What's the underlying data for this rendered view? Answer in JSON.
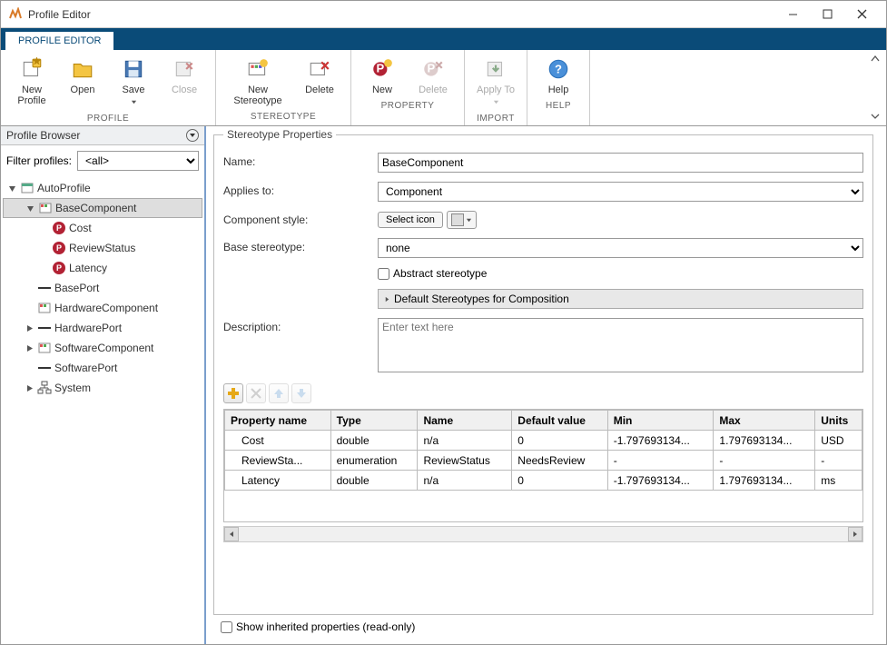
{
  "window": {
    "title": "Profile Editor"
  },
  "ribbon": {
    "tab": "PROFILE EDITOR",
    "groups": {
      "profile": {
        "name": "PROFILE",
        "new": "New Profile",
        "open": "Open",
        "save": "Save",
        "close": "Close"
      },
      "stereotype": {
        "name": "STEREOTYPE",
        "new": "New Stereotype",
        "delete": "Delete"
      },
      "property": {
        "name": "PROPERTY",
        "new": "New",
        "delete": "Delete"
      },
      "import": {
        "name": "IMPORT",
        "apply": "Apply To"
      },
      "help": {
        "name": "HELP",
        "help": "Help"
      }
    }
  },
  "browser": {
    "title": "Profile Browser",
    "filter_label": "Filter profiles:",
    "filter_value": "<all>",
    "tree": {
      "root": "AutoProfile",
      "items": [
        {
          "label": "BaseComponent",
          "icon": "grid",
          "indent": 1,
          "tw": "open",
          "selected": true
        },
        {
          "label": "Cost",
          "icon": "P",
          "indent": 2
        },
        {
          "label": "ReviewStatus",
          "icon": "P",
          "indent": 2
        },
        {
          "label": "Latency",
          "icon": "P",
          "indent": 2
        },
        {
          "label": "BasePort",
          "icon": "dash",
          "indent": 1
        },
        {
          "label": "HardwareComponent",
          "icon": "grid",
          "indent": 1
        },
        {
          "label": "HardwarePort",
          "icon": "dash",
          "indent": 1,
          "tw": "closed"
        },
        {
          "label": "SoftwareComponent",
          "icon": "grid",
          "indent": 1,
          "tw": "closed"
        },
        {
          "label": "SoftwarePort",
          "icon": "dash",
          "indent": 1
        },
        {
          "label": "System",
          "icon": "hier",
          "indent": 1,
          "tw": "closed"
        }
      ]
    }
  },
  "stereotype": {
    "legend": "Stereotype Properties",
    "labels": {
      "name": "Name:",
      "applies": "Applies to:",
      "compstyle": "Component style:",
      "base": "Base stereotype:",
      "abstract": "Abstract stereotype",
      "defaults": "Default Stereotypes for Composition",
      "description": "Description:",
      "select_icon": "Select icon"
    },
    "values": {
      "name": "BaseComponent",
      "applies": "Component",
      "base": "none",
      "desc_placeholder": "Enter text here"
    }
  },
  "props_table": {
    "headers": [
      "Property name",
      "Type",
      "Name",
      "Default value",
      "Min",
      "Max",
      "Units"
    ],
    "rows": [
      [
        "Cost",
        "double",
        "n/a",
        "0",
        "-1.797693134...",
        "1.797693134...",
        "USD"
      ],
      [
        "ReviewSta...",
        "enumeration",
        "ReviewStatus",
        "NeedsReview",
        "-",
        "-",
        "-"
      ],
      [
        "Latency",
        "double",
        "n/a",
        "0",
        "-1.797693134...",
        "1.797693134...",
        "ms"
      ]
    ]
  },
  "footer": {
    "show_inherited": "Show inherited properties (read-only)"
  }
}
